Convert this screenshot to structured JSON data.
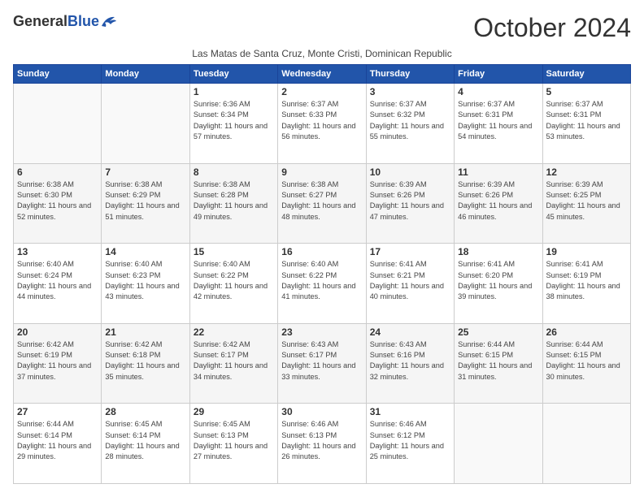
{
  "logo": {
    "general": "General",
    "blue": "Blue"
  },
  "title": "October 2024",
  "subtitle": "Las Matas de Santa Cruz, Monte Cristi, Dominican Republic",
  "days_header": [
    "Sunday",
    "Monday",
    "Tuesday",
    "Wednesday",
    "Thursday",
    "Friday",
    "Saturday"
  ],
  "weeks": [
    [
      {
        "day": "",
        "info": ""
      },
      {
        "day": "",
        "info": ""
      },
      {
        "day": "1",
        "info": "Sunrise: 6:36 AM\nSunset: 6:34 PM\nDaylight: 11 hours and 57 minutes."
      },
      {
        "day": "2",
        "info": "Sunrise: 6:37 AM\nSunset: 6:33 PM\nDaylight: 11 hours and 56 minutes."
      },
      {
        "day": "3",
        "info": "Sunrise: 6:37 AM\nSunset: 6:32 PM\nDaylight: 11 hours and 55 minutes."
      },
      {
        "day": "4",
        "info": "Sunrise: 6:37 AM\nSunset: 6:31 PM\nDaylight: 11 hours and 54 minutes."
      },
      {
        "day": "5",
        "info": "Sunrise: 6:37 AM\nSunset: 6:31 PM\nDaylight: 11 hours and 53 minutes."
      }
    ],
    [
      {
        "day": "6",
        "info": "Sunrise: 6:38 AM\nSunset: 6:30 PM\nDaylight: 11 hours and 52 minutes."
      },
      {
        "day": "7",
        "info": "Sunrise: 6:38 AM\nSunset: 6:29 PM\nDaylight: 11 hours and 51 minutes."
      },
      {
        "day": "8",
        "info": "Sunrise: 6:38 AM\nSunset: 6:28 PM\nDaylight: 11 hours and 49 minutes."
      },
      {
        "day": "9",
        "info": "Sunrise: 6:38 AM\nSunset: 6:27 PM\nDaylight: 11 hours and 48 minutes."
      },
      {
        "day": "10",
        "info": "Sunrise: 6:39 AM\nSunset: 6:26 PM\nDaylight: 11 hours and 47 minutes."
      },
      {
        "day": "11",
        "info": "Sunrise: 6:39 AM\nSunset: 6:26 PM\nDaylight: 11 hours and 46 minutes."
      },
      {
        "day": "12",
        "info": "Sunrise: 6:39 AM\nSunset: 6:25 PM\nDaylight: 11 hours and 45 minutes."
      }
    ],
    [
      {
        "day": "13",
        "info": "Sunrise: 6:40 AM\nSunset: 6:24 PM\nDaylight: 11 hours and 44 minutes."
      },
      {
        "day": "14",
        "info": "Sunrise: 6:40 AM\nSunset: 6:23 PM\nDaylight: 11 hours and 43 minutes."
      },
      {
        "day": "15",
        "info": "Sunrise: 6:40 AM\nSunset: 6:22 PM\nDaylight: 11 hours and 42 minutes."
      },
      {
        "day": "16",
        "info": "Sunrise: 6:40 AM\nSunset: 6:22 PM\nDaylight: 11 hours and 41 minutes."
      },
      {
        "day": "17",
        "info": "Sunrise: 6:41 AM\nSunset: 6:21 PM\nDaylight: 11 hours and 40 minutes."
      },
      {
        "day": "18",
        "info": "Sunrise: 6:41 AM\nSunset: 6:20 PM\nDaylight: 11 hours and 39 minutes."
      },
      {
        "day": "19",
        "info": "Sunrise: 6:41 AM\nSunset: 6:19 PM\nDaylight: 11 hours and 38 minutes."
      }
    ],
    [
      {
        "day": "20",
        "info": "Sunrise: 6:42 AM\nSunset: 6:19 PM\nDaylight: 11 hours and 37 minutes."
      },
      {
        "day": "21",
        "info": "Sunrise: 6:42 AM\nSunset: 6:18 PM\nDaylight: 11 hours and 35 minutes."
      },
      {
        "day": "22",
        "info": "Sunrise: 6:42 AM\nSunset: 6:17 PM\nDaylight: 11 hours and 34 minutes."
      },
      {
        "day": "23",
        "info": "Sunrise: 6:43 AM\nSunset: 6:17 PM\nDaylight: 11 hours and 33 minutes."
      },
      {
        "day": "24",
        "info": "Sunrise: 6:43 AM\nSunset: 6:16 PM\nDaylight: 11 hours and 32 minutes."
      },
      {
        "day": "25",
        "info": "Sunrise: 6:44 AM\nSunset: 6:15 PM\nDaylight: 11 hours and 31 minutes."
      },
      {
        "day": "26",
        "info": "Sunrise: 6:44 AM\nSunset: 6:15 PM\nDaylight: 11 hours and 30 minutes."
      }
    ],
    [
      {
        "day": "27",
        "info": "Sunrise: 6:44 AM\nSunset: 6:14 PM\nDaylight: 11 hours and 29 minutes."
      },
      {
        "day": "28",
        "info": "Sunrise: 6:45 AM\nSunset: 6:14 PM\nDaylight: 11 hours and 28 minutes."
      },
      {
        "day": "29",
        "info": "Sunrise: 6:45 AM\nSunset: 6:13 PM\nDaylight: 11 hours and 27 minutes."
      },
      {
        "day": "30",
        "info": "Sunrise: 6:46 AM\nSunset: 6:13 PM\nDaylight: 11 hours and 26 minutes."
      },
      {
        "day": "31",
        "info": "Sunrise: 6:46 AM\nSunset: 6:12 PM\nDaylight: 11 hours and 25 minutes."
      },
      {
        "day": "",
        "info": ""
      },
      {
        "day": "",
        "info": ""
      }
    ]
  ]
}
